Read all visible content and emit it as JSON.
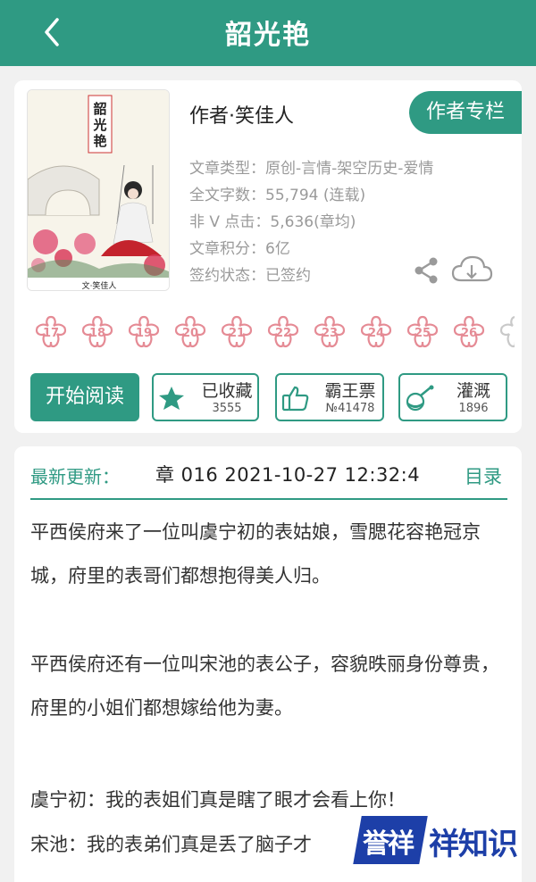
{
  "header": {
    "title": "韶光艳"
  },
  "book": {
    "cover_title": "韶光艳",
    "cover_author": "文·笑佳人",
    "author": "作者·笑佳人",
    "author_column_label": "作者专栏",
    "meta": [
      "文章类型：原创-言情-架空历史-爱情",
      "全文字数：55,794 (连载)",
      "非 V 点击：5,636(章均)",
      "文章积分：6亿",
      "签约状态：已签约"
    ]
  },
  "flower_numbers": [
    "17",
    "18",
    "19",
    "20",
    "21",
    "22",
    "23",
    "24",
    "25",
    "26"
  ],
  "actions": {
    "read_label": "开始阅读",
    "favorite": {
      "label": "已收藏",
      "count": "3555"
    },
    "bawang": {
      "label": "霸王票",
      "count": "№41478"
    },
    "irrigate": {
      "label": "灌溉",
      "count": "1896"
    }
  },
  "latest": {
    "label": "最新更新：",
    "text": "章  016  2021-10-27 12:32:4",
    "catalog": "目录"
  },
  "intro": [
    "平西侯府来了一位叫虞宁初的表姑娘，雪腮花容艳冠京城，府里的表哥们都想抱得美人归。",
    "平西侯府还有一位叫宋池的表公子，容貌昳丽身份尊贵，府里的小姐们都想嫁给他为妻。",
    "虞宁初：我的表姐们真是瞎了眼才会看上你！",
    "宋池：我的表弟们真是丢了脑子才"
  ],
  "watermark": {
    "badge": "誉祥",
    "text": "祥知识"
  },
  "colors": {
    "primary": "#2f9a83",
    "flower": "#e58b95",
    "watermark": "#1d3fa8"
  }
}
